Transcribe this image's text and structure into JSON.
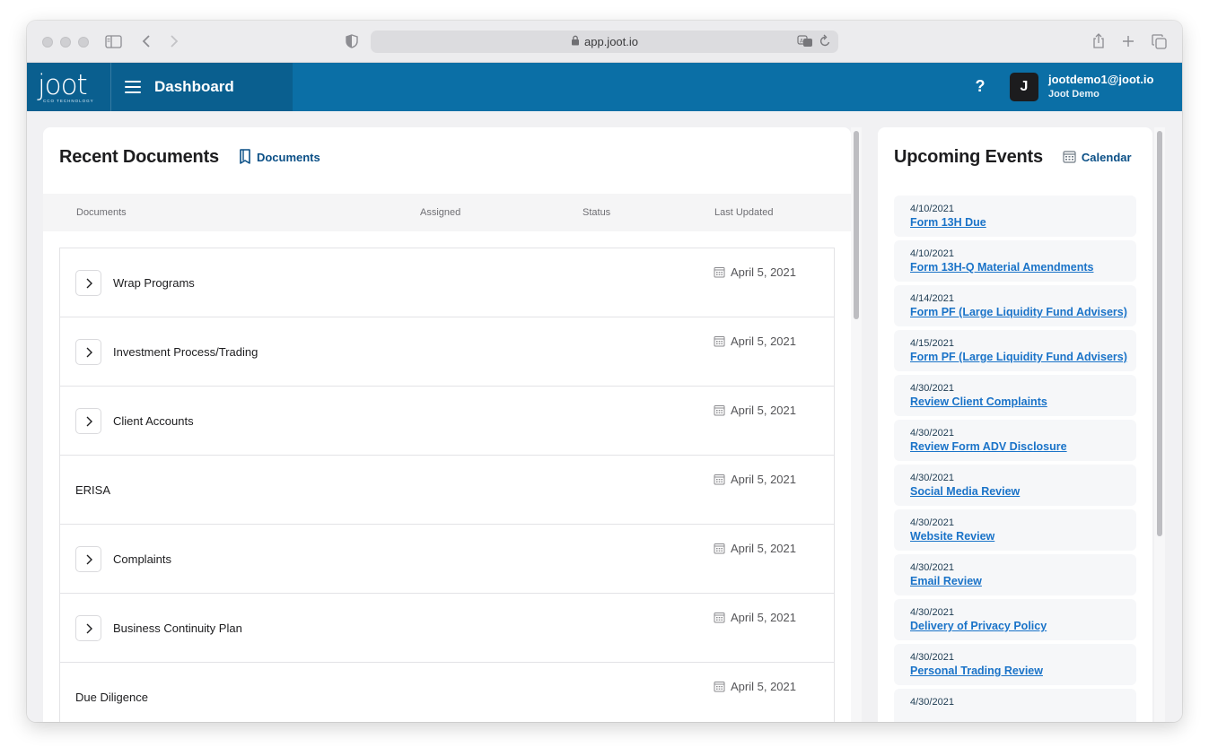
{
  "browser": {
    "url": "app.joot.io"
  },
  "app": {
    "logo_text": "joot",
    "logo_sub": "CCO TECHNOLOGY",
    "title": "Dashboard",
    "help_label": "?",
    "user": {
      "initial": "J",
      "email": "jootdemo1@joot.io",
      "name": "Joot Demo"
    },
    "colors": {
      "header": "#0b6fa6",
      "header_dark": "#0a5f8f",
      "link": "#1a73c8"
    }
  },
  "documents": {
    "title": "Recent Documents",
    "link_label": "Documents",
    "columns": [
      "Documents",
      "Assigned",
      "Status",
      "Last Updated"
    ],
    "rows": [
      {
        "name": "Wrap Programs",
        "date": "April 5, 2021",
        "expandable": true
      },
      {
        "name": "Investment Process/Trading",
        "date": "April 5, 2021",
        "expandable": true
      },
      {
        "name": "Client Accounts",
        "date": "April 5, 2021",
        "expandable": true
      },
      {
        "name": "ERISA",
        "date": "April 5, 2021",
        "expandable": false
      },
      {
        "name": "Complaints",
        "date": "April 5, 2021",
        "expandable": true
      },
      {
        "name": "Business Continuity Plan",
        "date": "April 5, 2021",
        "expandable": true
      },
      {
        "name": "Due Diligence",
        "date": "April 5, 2021",
        "expandable": false
      }
    ]
  },
  "events": {
    "title": "Upcoming Events",
    "link_label": "Calendar",
    "items": [
      {
        "date": "4/10/2021",
        "title": "Form 13H Due"
      },
      {
        "date": "4/10/2021",
        "title": "Form 13H-Q Material Amendments"
      },
      {
        "date": "4/14/2021",
        "title": "Form PF (Large Liquidity Fund Advisers)"
      },
      {
        "date": "4/15/2021",
        "title": "Form PF (Large Liquidity Fund Advisers)"
      },
      {
        "date": "4/30/2021",
        "title": "Review Client Complaints"
      },
      {
        "date": "4/30/2021",
        "title": "Review Form ADV Disclosure"
      },
      {
        "date": "4/30/2021",
        "title": "Social Media Review"
      },
      {
        "date": "4/30/2021",
        "title": "Website Review"
      },
      {
        "date": "4/30/2021",
        "title": "Email Review"
      },
      {
        "date": "4/30/2021",
        "title": "Delivery of Privacy Policy"
      },
      {
        "date": "4/30/2021",
        "title": "Personal Trading Review"
      },
      {
        "date": "4/30/2021",
        "title": ""
      }
    ]
  }
}
